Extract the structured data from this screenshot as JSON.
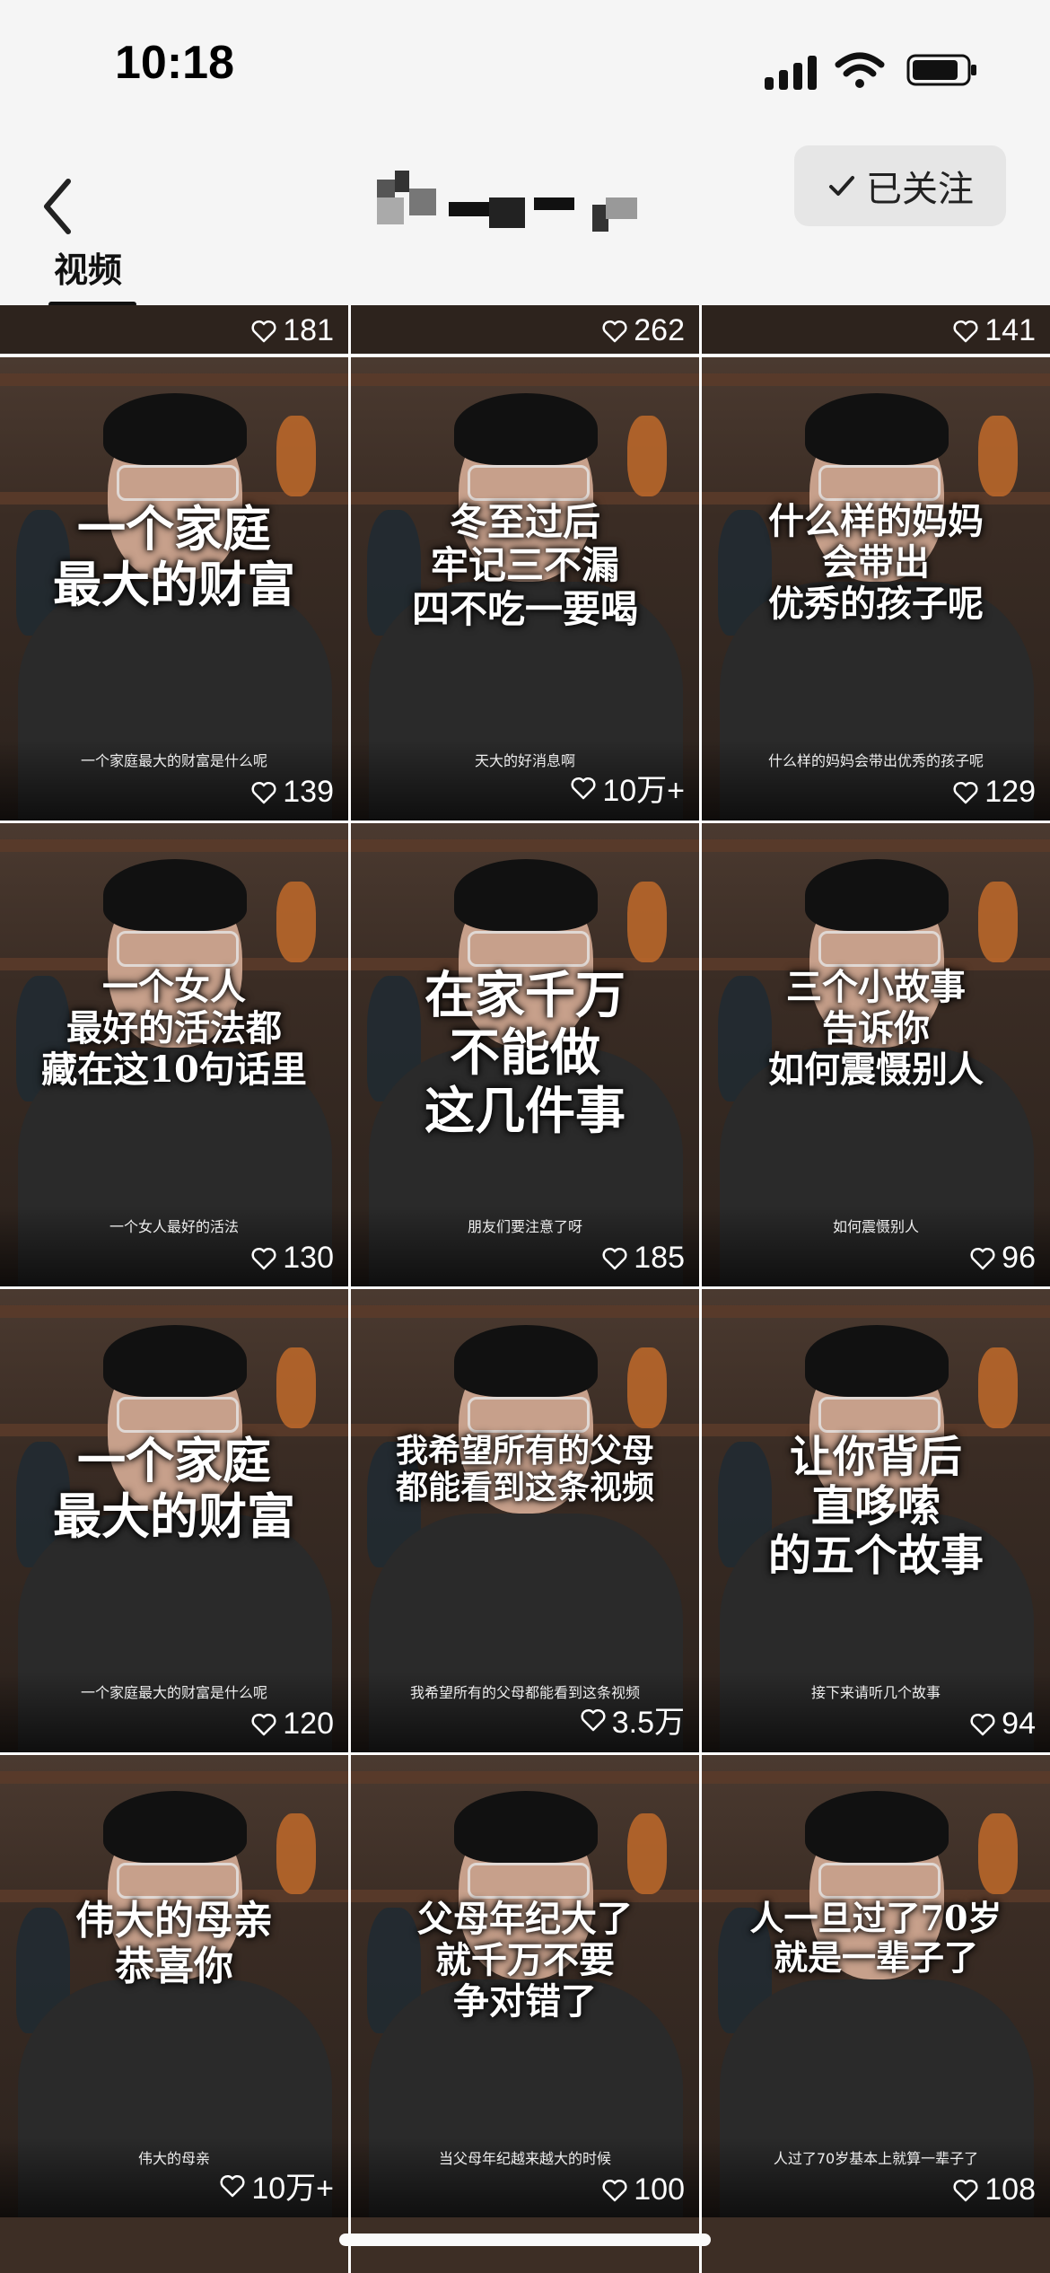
{
  "status_bar": {
    "time": "10:18",
    "battery_icon": "battery-icon",
    "wifi_icon": "wifi-icon",
    "signal_icon": "signal-icon"
  },
  "nav": {
    "back_icon": "chevron-left-icon",
    "follow_label": "已关注",
    "follow_icon": "checkmark-icon"
  },
  "tabs": [
    {
      "label": "视频"
    }
  ],
  "partial_top": [
    {
      "likes": "181"
    },
    {
      "likes": "262"
    },
    {
      "likes": "141"
    }
  ],
  "videos": [
    {
      "overlay": "一个家庭\n最大的财富",
      "caption": "一个家庭最大的财富是什么呢",
      "likes": "139"
    },
    {
      "overlay": "冬至过后\n牢记三不漏\n四不吃一要喝",
      "caption": "天大的好消息啊",
      "likes": "10万+"
    },
    {
      "overlay": "什么样的妈妈\n会带出\n优秀的孩子呢",
      "caption": "什么样的妈妈会带出优秀的孩子呢",
      "likes": "129"
    },
    {
      "overlay": "一个女人\n最好的活法都\n藏在这10句话里",
      "caption": "一个女人最好的活法",
      "likes": "130"
    },
    {
      "overlay": "在家千万\n不能做\n这几件事",
      "caption": "朋友们要注意了呀",
      "likes": "185"
    },
    {
      "overlay": "三个小故事\n告诉你\n如何震慑别人",
      "caption": "如何震慑别人",
      "likes": "96"
    },
    {
      "overlay": "一个家庭\n最大的财富",
      "caption": "一个家庭最大的财富是什么呢",
      "likes": "120"
    },
    {
      "overlay": "我希望所有的父母\n都能看到这条视频",
      "caption": "我希望所有的父母都能看到这条视频",
      "likes": "3.5万"
    },
    {
      "overlay": "让你背后\n直哆嗦\n的五个故事",
      "caption": "接下来请听几个故事",
      "likes": "94"
    },
    {
      "overlay": "伟大的母亲\n恭喜你",
      "caption": "伟大的母亲",
      "likes": "10万+"
    },
    {
      "overlay": "父母年纪大了\n就千万不要\n争对错了",
      "caption": "当父母年纪越来越大的时候",
      "likes": "100"
    },
    {
      "overlay": "人一旦过了70岁\n就是一辈子了",
      "caption": "人过了70岁基本上就算一辈子了",
      "likes": "108"
    }
  ]
}
